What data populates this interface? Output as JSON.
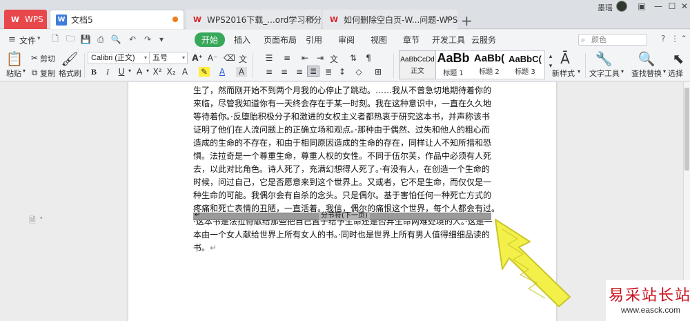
{
  "tabs": {
    "wps": "WPS",
    "doc": "文档5",
    "web1": "WPS2016下载_...ord学习和分享平台",
    "web2": "如何删除空白页-W...问题-WPS文字-",
    "add": "+"
  },
  "window": {
    "user": "墨瑶",
    "menu": "▣",
    "minimize": "—",
    "maximize": "☐",
    "close": "✕"
  },
  "menu": {
    "file": "文件",
    "ribbon_tabs": [
      "开始",
      "插入",
      "页面布局",
      "引用",
      "审阅",
      "视图",
      "章节",
      "开发工具",
      "云服务"
    ],
    "search_placeholder": "颜色",
    "help": "?"
  },
  "toolbar": {
    "paste": "粘贴",
    "cut": "剪切",
    "copy": "复制",
    "format_painter": "格式刷",
    "font_name": "Calibri (正文)",
    "font_size": "五号",
    "styles": [
      {
        "sample": "AaBbCcDd",
        "name": "正文"
      },
      {
        "sample": "AaBb",
        "name": "标题 1"
      },
      {
        "sample": "AaBb(",
        "name": "标题 2"
      },
      {
        "sample": "AaBbC(",
        "name": "标题 3"
      }
    ],
    "new_style": "新样式",
    "text_tools": "文字工具",
    "find_replace": "查找替换",
    "select": "选择"
  },
  "document": {
    "paragraph": "三个月以后，自我开始感觉到你不是我想象中的那个样子……我开始有点期盼你出生了，然而刚开始不到两个月我的心停止了跳动。……我从不曾急切地期待着你的来临，尽管我知道你有一天终会存在于某一时刻。我在这种意识中，一直在久久地等待着你。·反堕胎积极分子和激进的女权主义者都热衷于研究这本书，并声称该书证明了他们在人流问题上的正确立场和观点。·那种由于偶然、过失和他人的粗心而造成的生命的不存在，和由于相同原因造成的生命的存在，同样让人不知所措和恐惧。法拉奇是一个尊重生命，尊重人权的女性。不同于伍尔芙，作品中必须有人死去，以此对比角色。诗人死了，充满幻想得人死了。·有没有人，在创造一个生命的时候，问过自己，它是否愿意来到这个世界上。又或者，它不是生命，而仅仅是一种生命的可能。我偶尔会有自杀的念头。只是偶尔。基于害怕任何一种死亡方式的疼痛和死亡表情的丑陋，一直活着。我信，偶尔的痛恨这个世界，每个人都会有过。·这本书是法拉奇献给那些把自己置于给予生命还是否弃生命两难处境的人。·这是一本由一个女人献给世界上所有女人的书。·同时也是世界上所有男人值得细细品读的书。",
    "return_mark": "↵",
    "section_break": "分节符(下一页)"
  },
  "watermark": {
    "title": "易采站长站",
    "url": "www.easck.com"
  },
  "colors": {
    "active_tab": "#38a85b",
    "wps_red": "#e8474c",
    "arrow_fill": "#f3f04a",
    "arrow_stroke": "#c9c52a",
    "watermark_red": "#c8101a"
  }
}
